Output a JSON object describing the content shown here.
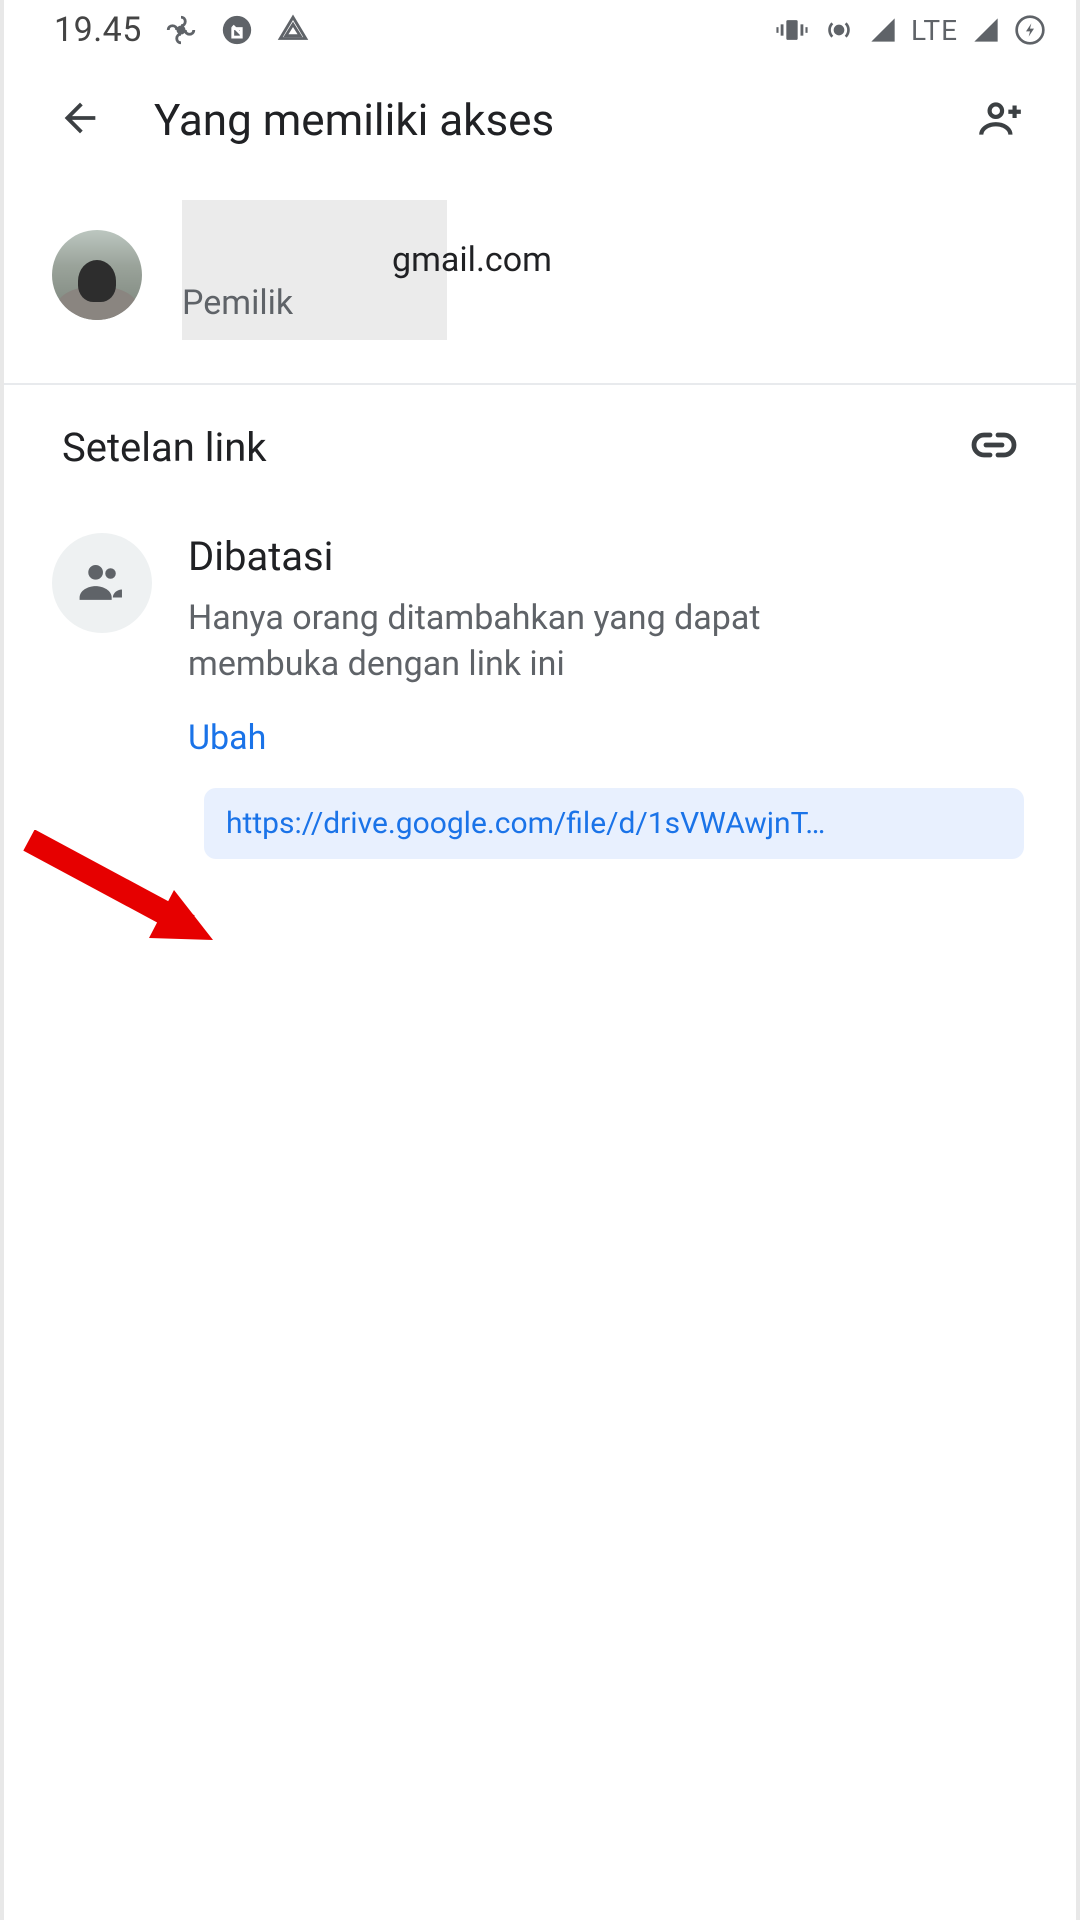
{
  "status_bar": {
    "time": "19.45",
    "network_label": "LTE"
  },
  "header": {
    "title": "Yang memiliki akses"
  },
  "owner": {
    "email_suffix": "gmail.com",
    "role": "Pemilik"
  },
  "link_settings": {
    "section_title": "Setelan link",
    "restricted_title": "Dibatasi",
    "restricted_description": "Hanya orang ditambahkan yang dapat membuka dengan link ini",
    "change_label": "Ubah",
    "share_link": "https://drive.google.com/file/d/1sVWAwjnT…"
  }
}
